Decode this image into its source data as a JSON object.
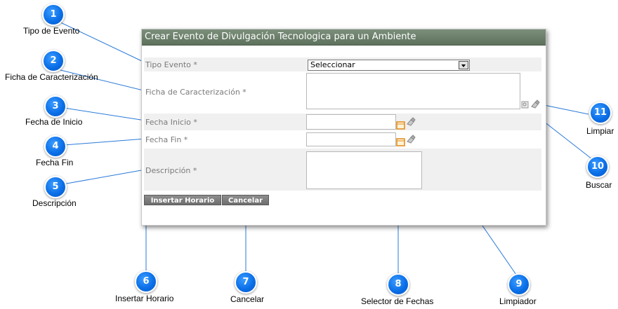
{
  "dialog": {
    "title": "Crear Evento de Divulgación Tecnologica para un Ambiente",
    "fields": {
      "tipo_evento_label": "Tipo Evento *",
      "tipo_evento_value": "Seleccionar",
      "ficha_label": "Ficha de Caracterización *",
      "fecha_inicio_label": "Fecha Inicio *",
      "fecha_fin_label": "Fecha Fin *",
      "descripcion_label": "Descripción *"
    },
    "buttons": {
      "insertar": "Insertar Horario",
      "cancelar": "Cancelar"
    }
  },
  "callouts": [
    {
      "number": "1",
      "label": "Tipo de Evento"
    },
    {
      "number": "2",
      "label": "Ficha de Caracterización"
    },
    {
      "number": "3",
      "label": "Fecha de Inicio"
    },
    {
      "number": "4",
      "label": "Fecha Fin"
    },
    {
      "number": "5",
      "label": "Descripción"
    },
    {
      "number": "6",
      "label": "Insertar Horario"
    },
    {
      "number": "7",
      "label": "Cancelar"
    },
    {
      "number": "8",
      "label": "Selector de Fechas"
    },
    {
      "number": "9",
      "label": "Limpiador"
    },
    {
      "number": "10",
      "label": "Buscar"
    },
    {
      "number": "11",
      "label": "Limpiar"
    }
  ],
  "colors": {
    "title_bar": "#6b7f6b",
    "callout": "#0b6fe8",
    "button": "#7d7d7d"
  }
}
